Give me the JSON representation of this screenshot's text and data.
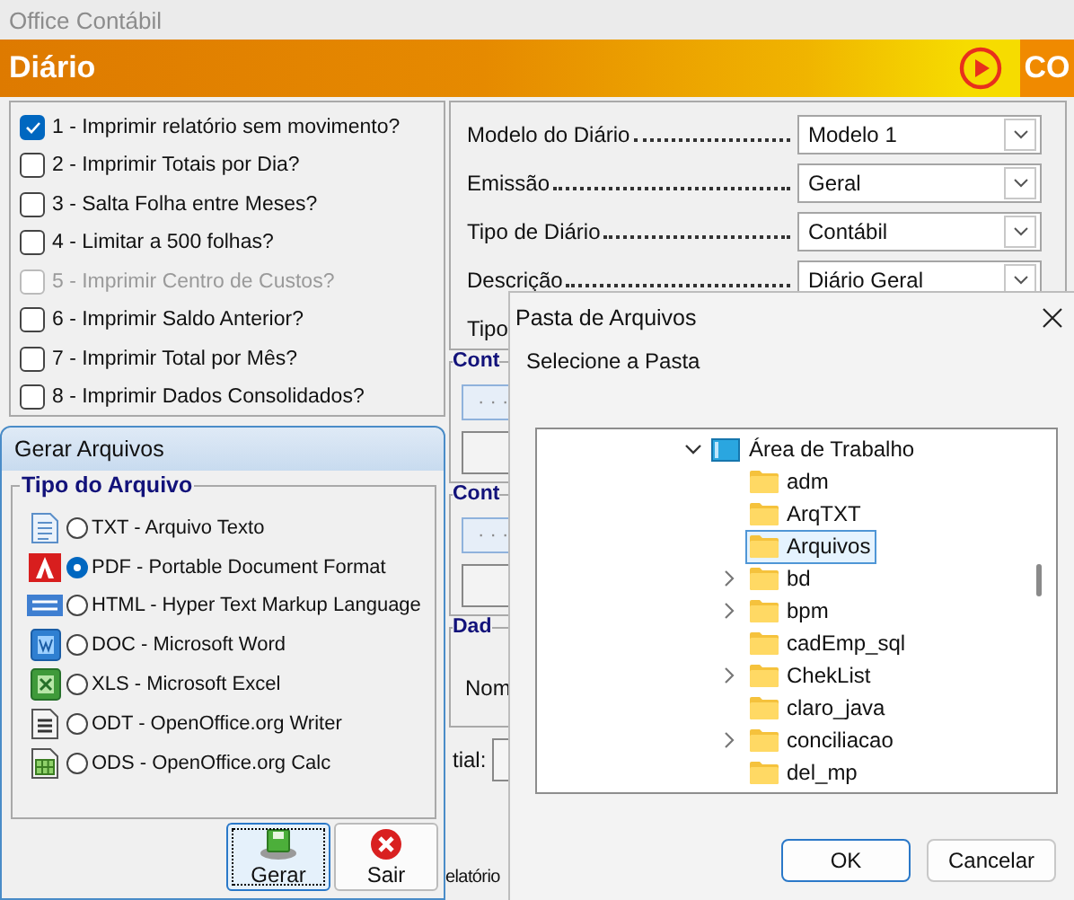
{
  "window": {
    "title": "Office Contábil"
  },
  "header": {
    "title": "Diário",
    "badge": "CO"
  },
  "options": [
    {
      "label": "1 - Imprimir relatório sem movimento?",
      "checked": true,
      "disabled": false
    },
    {
      "label": "2 - Imprimir Totais por Dia?",
      "checked": false,
      "disabled": false
    },
    {
      "label": "3 - Salta Folha entre Meses?",
      "checked": false,
      "disabled": false
    },
    {
      "label": "4 - Limitar a 500 folhas?",
      "checked": false,
      "disabled": false
    },
    {
      "label": "5 - Imprimir Centro de Custos?",
      "checked": false,
      "disabled": true
    },
    {
      "label": "6 - Imprimir Saldo Anterior?",
      "checked": false,
      "disabled": false
    },
    {
      "label": "7 - Imprimir Total por Mês?",
      "checked": false,
      "disabled": false
    },
    {
      "label": "8 - Imprimir Dados Consolidados?",
      "checked": false,
      "disabled": false
    }
  ],
  "form": [
    {
      "label": "Modelo do Diário",
      "value": "Modelo 1"
    },
    {
      "label": "Emissão",
      "value": "Geral"
    },
    {
      "label": "Tipo de Diário",
      "value": "Contábil"
    },
    {
      "label": "Descrição",
      "value": "Diário Geral"
    },
    {
      "label": "Tipo"
    }
  ],
  "background_sections": {
    "groups": [
      {
        "legend": "Cont",
        "button": "· · ·"
      },
      {
        "legend": "Cont",
        "button": "· · ·"
      },
      {
        "legend": "Dad",
        "label": "Nom"
      }
    ],
    "field_label": "tial:",
    "footer_label": "elatório"
  },
  "export_dialog": {
    "title": "Gerar Arquivos",
    "group": "Tipo do Arquivo",
    "formats": [
      {
        "kind": "txt",
        "label": "TXT - Arquivo Texto",
        "selected": false
      },
      {
        "kind": "pdf",
        "label": "PDF - Portable Document Format",
        "selected": true
      },
      {
        "kind": "html",
        "label": "HTML - Hyper Text Markup Language",
        "selected": false
      },
      {
        "kind": "doc",
        "label": "DOC - Microsoft Word",
        "selected": false
      },
      {
        "kind": "xls",
        "label": "XLS - Microsoft Excel",
        "selected": false
      },
      {
        "kind": "odt",
        "label": "ODT - OpenOffice.org Writer",
        "selected": false
      },
      {
        "kind": "ods",
        "label": "ODS - OpenOffice.org Calc",
        "selected": false
      }
    ],
    "buttons": [
      {
        "kind": "save",
        "label": "Gerar"
      },
      {
        "kind": "exit",
        "label": "Sair"
      }
    ]
  },
  "folder_dialog": {
    "title": "Pasta de Arquivos",
    "prompt": "Selecione a Pasta",
    "tree": {
      "label": "Área de Trabalho",
      "expanded": true,
      "children": [
        {
          "label": "adm",
          "expandable": false,
          "selected": false
        },
        {
          "label": "ArqTXT",
          "expandable": false,
          "selected": false
        },
        {
          "label": "Arquivos",
          "expandable": false,
          "selected": true
        },
        {
          "label": "bd",
          "expandable": true,
          "selected": false
        },
        {
          "label": "bpm",
          "expandable": true,
          "selected": false
        },
        {
          "label": "cadEmp_sql",
          "expandable": false,
          "selected": false
        },
        {
          "label": "ChekList",
          "expandable": true,
          "selected": false
        },
        {
          "label": "claro_java",
          "expandable": false,
          "selected": false
        },
        {
          "label": "conciliacao",
          "expandable": true,
          "selected": false
        },
        {
          "label": "del_mp",
          "expandable": false,
          "selected": false
        }
      ]
    },
    "buttons": [
      "OK",
      "Cancelar"
    ]
  }
}
